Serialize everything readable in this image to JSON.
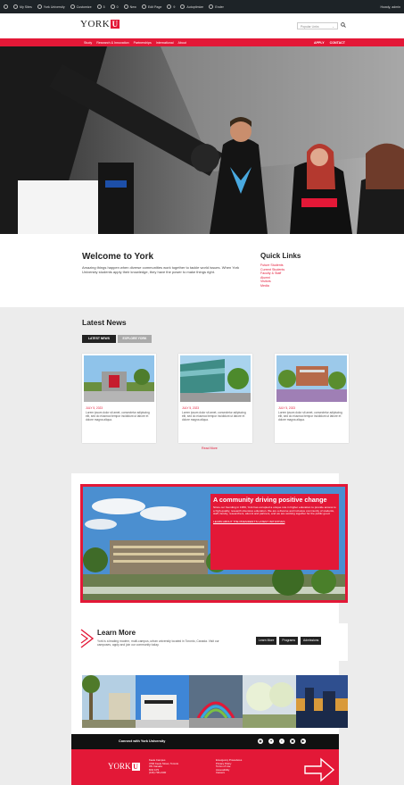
{
  "admin_bar": {
    "items": [
      "My Sites",
      "York University",
      "Customize",
      "5",
      "0",
      "New",
      "Edit Page",
      "9",
      "Autoptimize",
      "Ender"
    ],
    "account": "Howdy, admin"
  },
  "header": {
    "logo_text": "YORK",
    "logo_mark": "U",
    "search_placeholder": "Popular Links",
    "search_glyph": "⌄",
    "search_icon": "search-icon"
  },
  "nav": {
    "left": [
      "Study",
      "Research & Innovation",
      "Partnerships",
      "International",
      "About"
    ],
    "right": [
      "APPLY",
      "CONTACT"
    ]
  },
  "welcome": {
    "title": "Welcome to York",
    "body": "Amazing things happen when diverse communities work together to tackle world issues. When York University students apply their knowledge, they have the power to make things right."
  },
  "quick_links": {
    "title": "Quick Links",
    "items": [
      "Future Students",
      "Current Students",
      "Faculty & Staff",
      "Alumni",
      "Visitors",
      "Media"
    ]
  },
  "news": {
    "title": "Latest News",
    "tabs": [
      "LATEST NEWS",
      "EXPLORE YORK"
    ],
    "cards": [
      {
        "date": "JULY 5, 2023",
        "body": "Lorem ipsum dolor sit amet, consectetur adipiscing elit, sed do eiusmod tempor incididunt ut labore et dolore magna aliqua."
      },
      {
        "date": "JULY 5, 2023",
        "body": "Lorem ipsum dolor sit amet, consectetur adipiscing elit, sed do eiusmod tempor incididunt ut labore et dolore magna aliqua."
      },
      {
        "date": "JULY 5, 2023",
        "body": "Lorem ipsum dolor sit amet, consectetur adipiscing elit, sed do eiusmod tempor incididunt ut labore et dolore magna aliqua."
      }
    ],
    "read_more": "Read More"
  },
  "community": {
    "title": "A community driving positive change",
    "body": "Since our founding in 1959, York has occupied a unique role in higher education to provide access to a high-quality, research-intensive education. We are a diverse and inclusive community of students, staff, faculty, researchers, alumni and partners, and we are working together for the public good.",
    "link": "LEARN ABOUT THE PRESIDENT'S LATEST INITIATIVES"
  },
  "learn_more": {
    "title": "Learn More",
    "body": "York is a leading modern, multi-campus, urban university located in Toronto, Canada. Visit our campuses, apply and join our community today.",
    "buttons": [
      "Learn More",
      "Programs",
      "Admissions"
    ]
  },
  "connect": {
    "label": "Connect with York University",
    "social_icons": [
      "instagram-icon",
      "twitter-icon",
      "linkedin-icon",
      "facebook-icon",
      "youtube-icon"
    ]
  },
  "footer": {
    "logo_text": "YORK",
    "logo_mark": "U",
    "address": [
      "Keele Campus",
      "4700 Keele Street, Toronto",
      "ON Canada",
      "M3J 1P3",
      "(416) 736-2100"
    ],
    "links": [
      "Emergency Procedures",
      "Privacy Policy",
      "Terms of Use",
      "Accessibility",
      "Careers"
    ]
  },
  "colors": {
    "brand_red": "#e31837",
    "dark": "#222222",
    "grey_band": "#ececec"
  }
}
